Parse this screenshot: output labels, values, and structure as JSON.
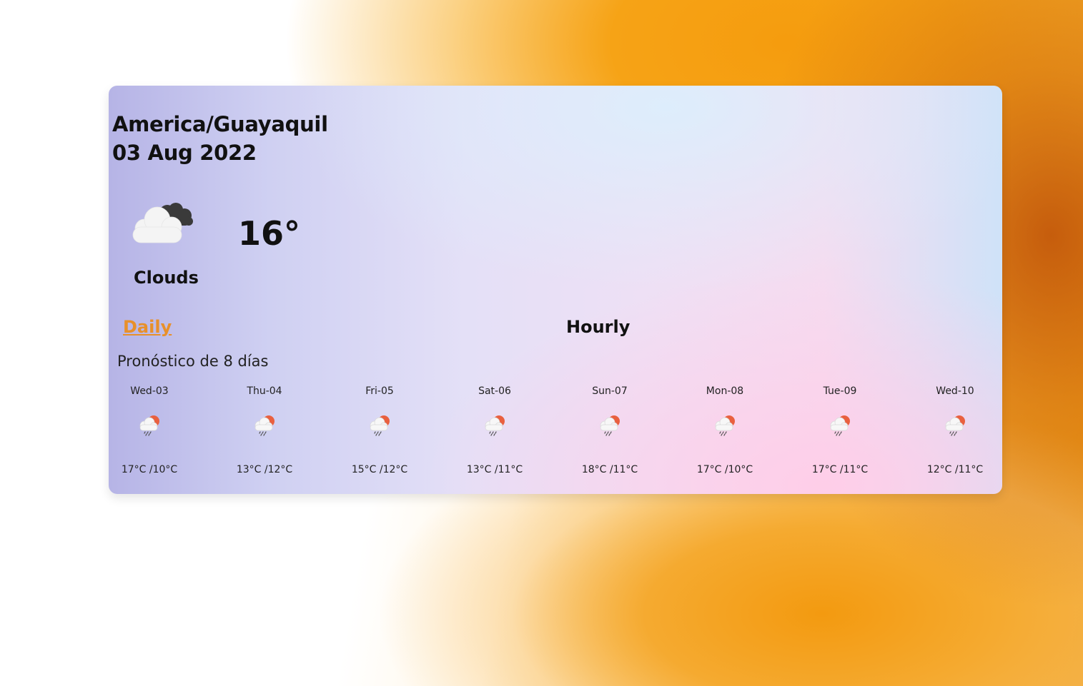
{
  "location": {
    "timezone": "America/Guayaquil",
    "date": "03 Aug 2022"
  },
  "current": {
    "icon": "clouds-icon",
    "temperature": "16°",
    "description": "Clouds"
  },
  "tabs": {
    "daily": "Daily",
    "hourly": "Hourly"
  },
  "forecast": {
    "title": "Pronóstico de 8 días",
    "days": [
      {
        "day": "Wed-03",
        "icon": "rain-sun-icon",
        "temps": "17°C /10°C"
      },
      {
        "day": "Thu-04",
        "icon": "rain-sun-icon",
        "temps": "13°C /12°C"
      },
      {
        "day": "Fri-05",
        "icon": "rain-sun-icon",
        "temps": "15°C /12°C"
      },
      {
        "day": "Sat-06",
        "icon": "rain-sun-icon",
        "temps": "13°C /11°C"
      },
      {
        "day": "Sun-07",
        "icon": "rain-sun-icon",
        "temps": "18°C /11°C"
      },
      {
        "day": "Mon-08",
        "icon": "rain-sun-icon",
        "temps": "17°C /10°C"
      },
      {
        "day": "Tue-09",
        "icon": "rain-sun-icon",
        "temps": "17°C /11°C"
      },
      {
        "day": "Wed-10",
        "icon": "rain-sun-icon",
        "temps": "12°C /11°C"
      }
    ]
  },
  "colors": {
    "accent": "#e8902a",
    "text": "#111111"
  }
}
